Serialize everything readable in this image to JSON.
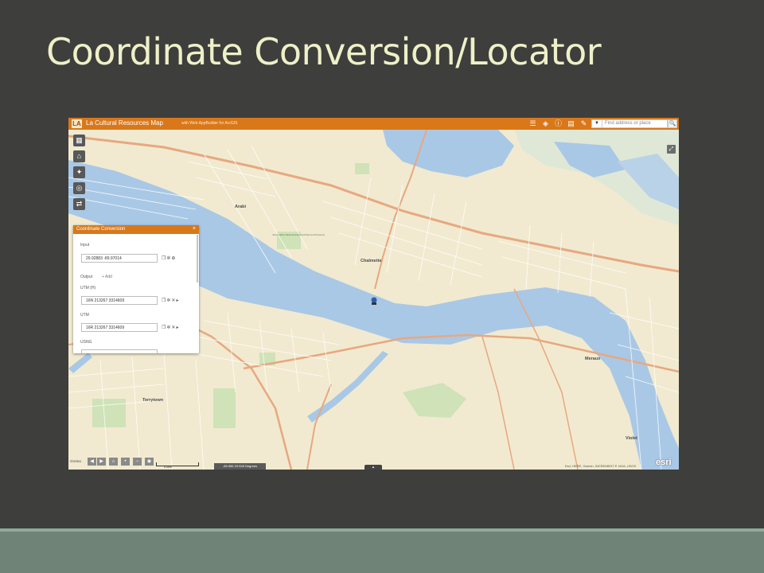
{
  "slide": {
    "title": "Coordinate Conversion/Locator"
  },
  "app": {
    "logo_text": "LA",
    "title": "La Cultural Resources Map",
    "subtitle": "with Web AppBuilder for ArcGIS",
    "header_icons": [
      "layer-list-icon",
      "basemap-icon",
      "info-icon",
      "print-icon",
      "draw-icon"
    ],
    "search": {
      "placeholder": "Find address or place",
      "dropdown": "▼",
      "button": "🔍"
    },
    "colors": {
      "header": "#d8781a",
      "water": "#a9c8e6",
      "land": "#f1ead0",
      "roads": "#e7a880"
    }
  },
  "map": {
    "labels": {
      "arabi": "Arabi",
      "chalmette": "Chalmette",
      "meraux": "Meraux",
      "terrytown": "Terrytown",
      "violet": "Violet",
      "gretna": "Gretna",
      "park": "Jean Lafitte National Historical Park and Preserve"
    },
    "attribution": "Esri, HERE, Garmin, INCREMENT P, NGA, USGS",
    "coord_readout": "-89.956 29.928 Degrees",
    "scale_label": "0.6mi",
    "esri_logo": "esri"
  },
  "coordinate_conversion": {
    "title": "Coordinate Conversion",
    "close": "×",
    "input_label": "Input",
    "input_value": "29.92883 -89.97014",
    "output_label": "Output",
    "add_label": "+ Add",
    "outputs": [
      {
        "label": "UTM (H)",
        "value": "16N 213267 3314609"
      },
      {
        "label": "UTM",
        "value": "16R 213267 3314609"
      },
      {
        "label": "USNG",
        "value": ""
      }
    ],
    "icons": [
      "copy-icon",
      "settings-icon",
      "close-icon",
      "expand-icon"
    ]
  }
}
